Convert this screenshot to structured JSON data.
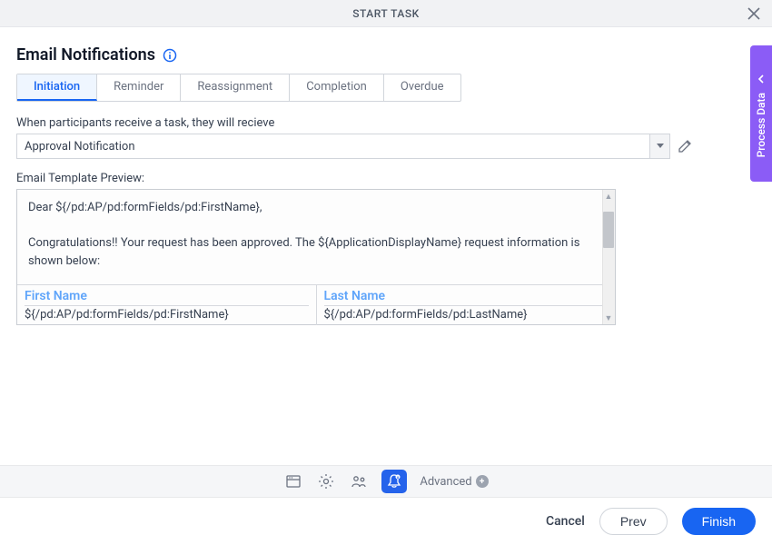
{
  "header": {
    "title": "START TASK"
  },
  "section": {
    "title": "Email Notifications"
  },
  "tabs": [
    "Initiation",
    "Reminder",
    "Reassignment",
    "Completion",
    "Overdue"
  ],
  "activeTab": 0,
  "dropdown": {
    "label": "When participants receive a task, they will recieve",
    "value": "Approval Notification"
  },
  "preview": {
    "label": "Email Template Preview:",
    "greeting": "Dear ${/pd:AP/pd:formFields/pd:FirstName},",
    "body": "Congratulations!! Your request has been approved. The ${ApplicationDisplayName} request information is shown below:",
    "cols": [
      {
        "header": "First Name",
        "value": "${/pd:AP/pd:formFields/pd:FirstName}"
      },
      {
        "header": "Last Name",
        "value": "${/pd:AP/pd:formFields/pd:LastName}"
      }
    ]
  },
  "sidePanel": {
    "label": "Process Data"
  },
  "advanced": {
    "label": "Advanced"
  },
  "footer": {
    "cancel": "Cancel",
    "prev": "Prev",
    "finish": "Finish"
  }
}
